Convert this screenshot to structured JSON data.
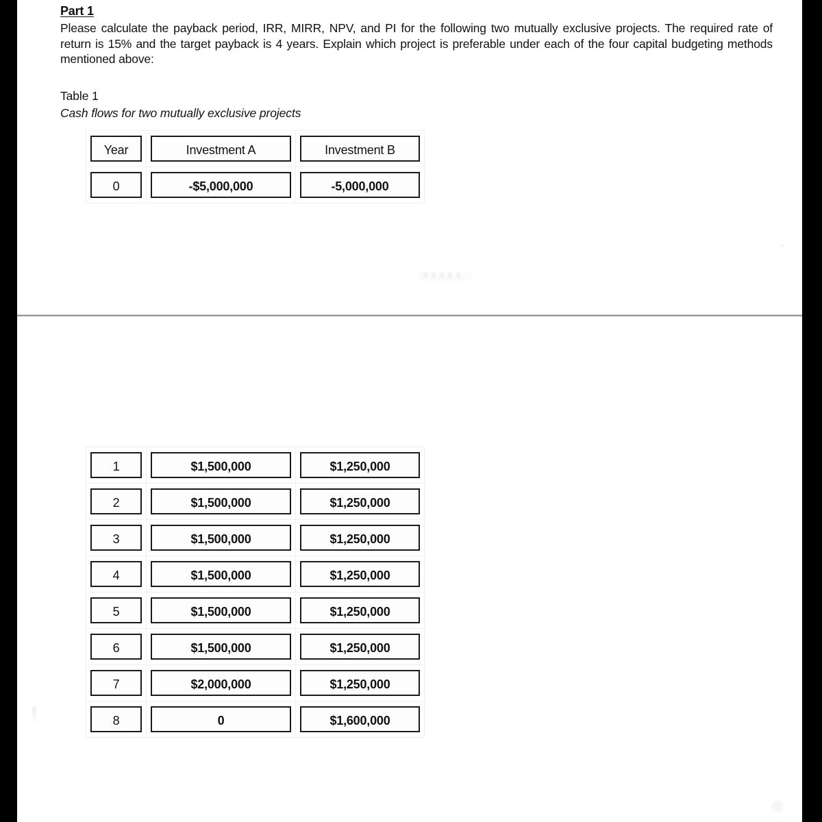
{
  "document": {
    "part_heading": "Part 1",
    "question_body": "Please calculate the payback period, IRR, MIRR, NPV, and PI for the following two mutually exclusive projects. The required rate of return is 15% and the target payback is 4 years. Explain which project is preferable under each of the four capital budgeting methods mentioned above:",
    "table_label": "Table 1",
    "table_caption": "Cash flows for two mutually exclusive projects"
  },
  "table": {
    "headers": [
      "Year",
      "Investment A",
      "Investment B"
    ],
    "rows_top": [
      {
        "year": "0",
        "a": "-$5,000,000",
        "b": "-5,000,000"
      }
    ],
    "rows_bottom": [
      {
        "year": "1",
        "a": "$1,500,000",
        "b": "$1,250,000"
      },
      {
        "year": "2",
        "a": "$1,500,000",
        "b": "$1,250,000"
      },
      {
        "year": "3",
        "a": "$1,500,000",
        "b": "$1,250,000"
      },
      {
        "year": "4",
        "a": "$1,500,000",
        "b": "$1,250,000"
      },
      {
        "year": "5",
        "a": "$1,500,000",
        "b": "$1,250,000"
      },
      {
        "year": "6",
        "a": "$1,500,000",
        "b": "$1,250,000"
      },
      {
        "year": "7",
        "a": "$2,000,000",
        "b": "$1,250,000"
      },
      {
        "year": "8",
        "a": "0",
        "b": "$1,600,000"
      }
    ]
  }
}
